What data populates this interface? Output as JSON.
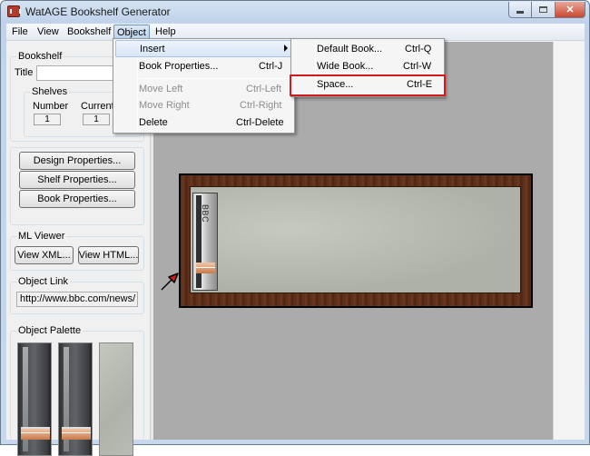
{
  "window": {
    "title": "WatAGE Bookshelf Generator",
    "close_glyph": "✕"
  },
  "menubar": {
    "items": [
      "File",
      "View",
      "Bookshelf",
      "Object",
      "Help"
    ],
    "active": "Object"
  },
  "left_panel": {
    "bookshelf_group": {
      "label": "Bookshelf",
      "title_label": "Title",
      "title_value": "",
      "shelves_group": {
        "label": "Shelves",
        "number_label": "Number",
        "number_value": "1",
        "current_label": "Current",
        "current_value": "1"
      }
    },
    "buttons": {
      "design_properties": "Design Properties...",
      "shelf_properties": "Shelf Properties...",
      "book_properties": "Book Properties..."
    },
    "ml_viewer": {
      "label": "ML Viewer",
      "view_xml": "View XML...",
      "view_html": "View HTML..."
    },
    "object_link": {
      "label": "Object Link",
      "value": "http://www.bbc.com/news/"
    },
    "object_palette": {
      "label": "Object Palette",
      "items": [
        "book",
        "wide-book",
        "space"
      ]
    }
  },
  "canvas": {
    "background": "#ababab",
    "shelf": {
      "books": [
        {
          "title": "BBC",
          "selected": true
        }
      ]
    },
    "pointer_color": "#d11a1a"
  },
  "object_menu": {
    "items": [
      {
        "label": "Insert",
        "shortcut": "",
        "disabled": false,
        "has_submenu": true,
        "hover": true
      },
      {
        "label": "Book Properties...",
        "shortcut": "Ctrl-J",
        "disabled": false
      },
      {
        "label": "Move Left",
        "shortcut": "Ctrl-Left",
        "disabled": true
      },
      {
        "label": "Move Right",
        "shortcut": "Ctrl-Right",
        "disabled": true
      },
      {
        "label": "Delete",
        "shortcut": "Ctrl-Delete",
        "disabled": false
      }
    ]
  },
  "insert_submenu": {
    "items": [
      {
        "label": "Default Book...",
        "shortcut": "Ctrl-Q"
      },
      {
        "label": "Wide Book...",
        "shortcut": "Ctrl-W"
      },
      {
        "label": "Space...",
        "shortcut": "Ctrl-E",
        "highlighted": true
      }
    ],
    "highlight_color": "#d11a1a"
  }
}
